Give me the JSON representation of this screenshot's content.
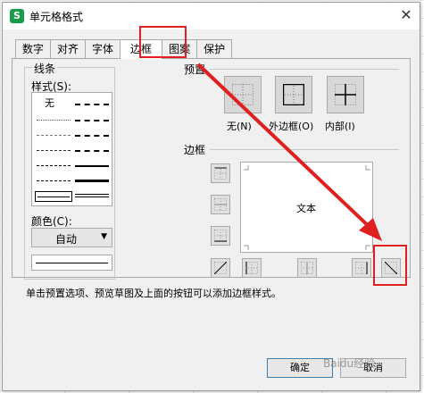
{
  "window": {
    "title": "单元格格式",
    "app_icon": "S",
    "close_glyph": "✕"
  },
  "tabs": [
    {
      "label": "数字"
    },
    {
      "label": "对齐"
    },
    {
      "label": "字体"
    },
    {
      "label": "边框"
    },
    {
      "label": "图案"
    },
    {
      "label": "保护"
    }
  ],
  "line_group": {
    "title": "线条",
    "style_label": "样式(S):",
    "none_label": "无",
    "color_label": "颜色(C):",
    "color_value": "自动"
  },
  "presets": {
    "title": "预置",
    "items": [
      {
        "label": "无(N)"
      },
      {
        "label": "外边框(O)"
      },
      {
        "label": "内部(I)"
      }
    ]
  },
  "border": {
    "title": "边框",
    "preview_text": "文本"
  },
  "hint": "单击预置选项、预览草图及上面的按钮可以添加边框样式。",
  "buttons": {
    "ok": "确定",
    "cancel": "取消"
  },
  "watermark": "Baidu经验",
  "colors": {
    "highlight": "#e02020",
    "app_icon": "#1a9c4e"
  }
}
